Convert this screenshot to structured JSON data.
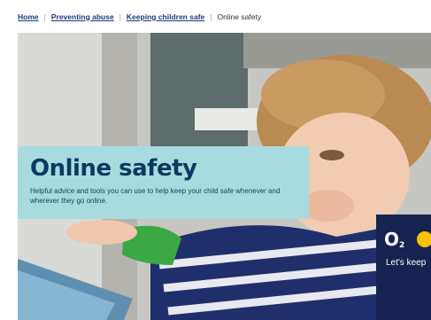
{
  "breadcrumb": {
    "items": [
      "Home",
      "Preventing abuse",
      "Keeping children safe"
    ],
    "separator": "|",
    "current": "Online safety"
  },
  "hero": {
    "title": "Online safety",
    "description": "Helpful advice and tools you can use to help keep your child safe whenever and wherever they go online.",
    "panel_color": "#a8dbe0",
    "title_color": "#0b3b5c"
  },
  "partner": {
    "logo_text": "O",
    "logo_subscript": "2",
    "tagline": "Let's keep"
  }
}
